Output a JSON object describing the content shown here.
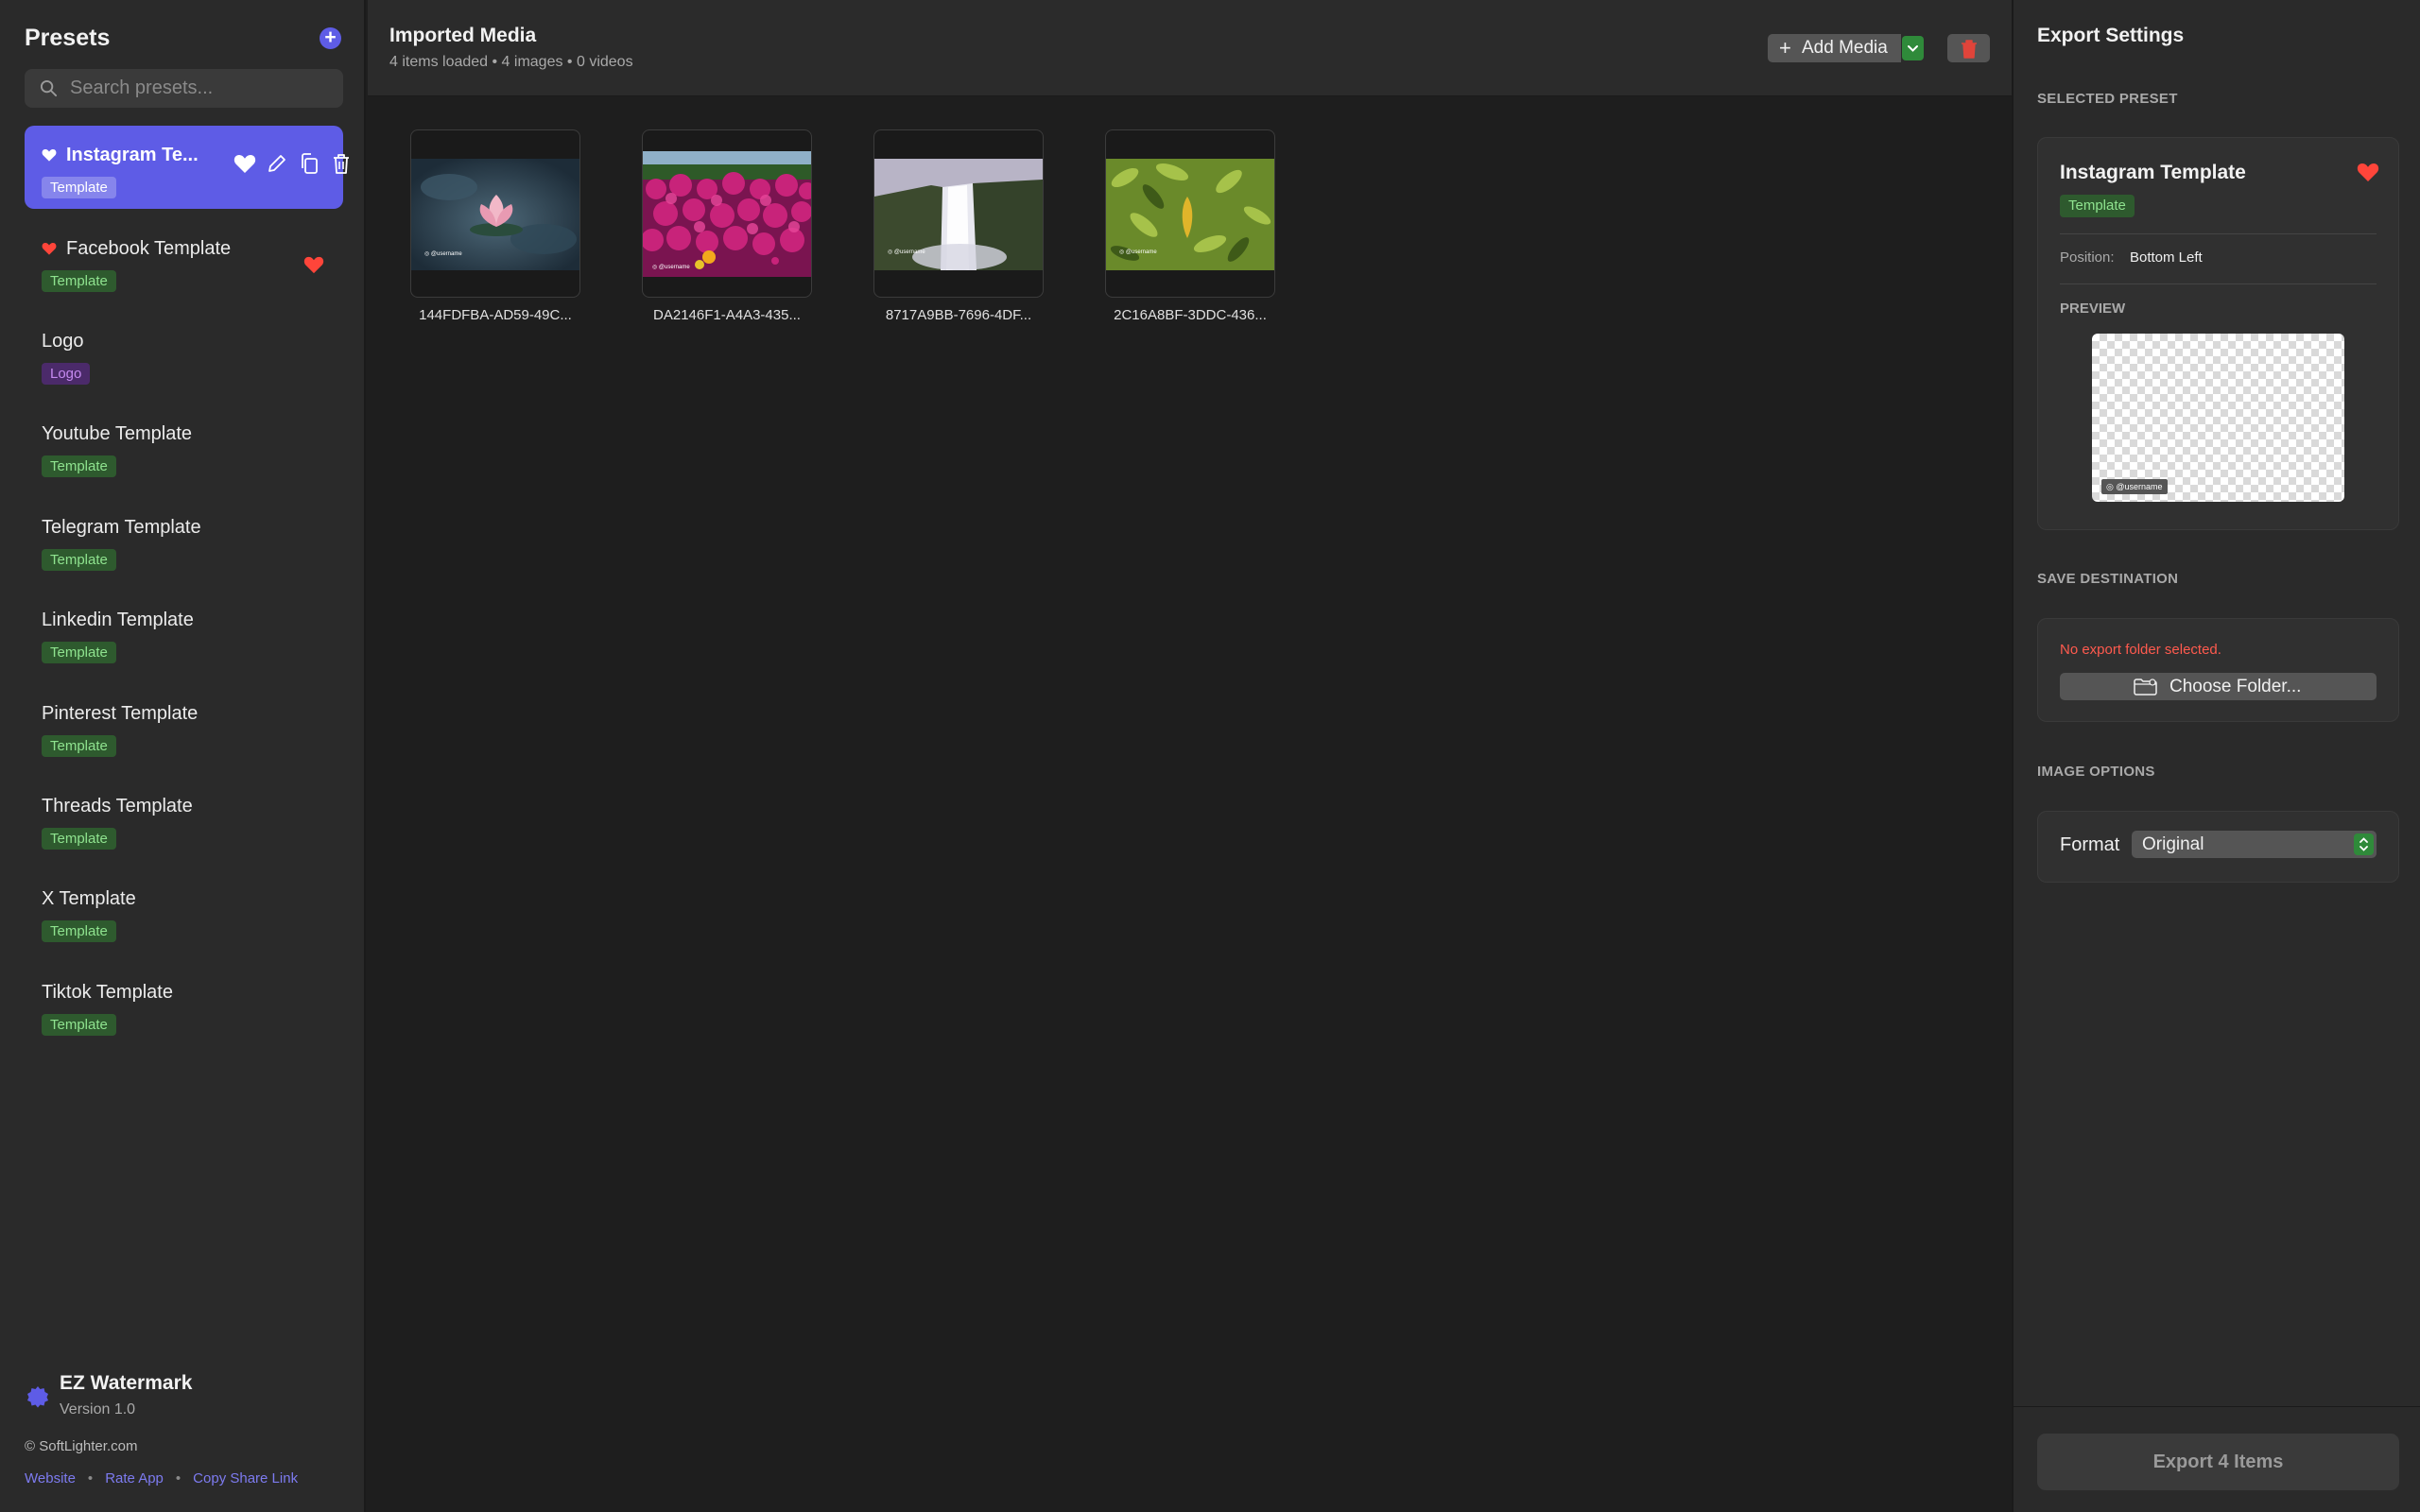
{
  "sidebar": {
    "title": "Presets",
    "search_placeholder": "Search presets...",
    "presets": [
      {
        "name": "Instagram Template",
        "short_name": "Instagram Te...",
        "tag": "Template",
        "favorite": true,
        "selected": true
      },
      {
        "name": "Facebook Template",
        "tag": "Template",
        "favorite": true,
        "selected": false
      },
      {
        "name": "Logo",
        "tag": "Logo",
        "favorite": false,
        "selected": false
      },
      {
        "name": "Youtube Template",
        "tag": "Template",
        "favorite": false,
        "selected": false
      },
      {
        "name": "Telegram Template",
        "tag": "Template",
        "favorite": false,
        "selected": false
      },
      {
        "name": "Linkedin Template",
        "tag": "Template",
        "favorite": false,
        "selected": false
      },
      {
        "name": "Pinterest Template",
        "tag": "Template",
        "favorite": false,
        "selected": false
      },
      {
        "name": "Threads Template",
        "tag": "Template",
        "favorite": false,
        "selected": false
      },
      {
        "name": "X Template",
        "tag": "Template",
        "favorite": false,
        "selected": false
      },
      {
        "name": "Tiktok Template",
        "tag": "Template",
        "favorite": false,
        "selected": false
      }
    ],
    "app": {
      "name": "EZ Watermark",
      "version": "Version 1.0"
    },
    "copyright": "© SoftLighter.com",
    "links": [
      "Website",
      "Rate App",
      "Copy Share Link"
    ]
  },
  "main": {
    "title": "Imported Media",
    "subtitle": "4 items loaded • 4 images • 0 videos",
    "add_media_label": "Add Media",
    "media": [
      {
        "name": "144FDFBA-AD59-49C...",
        "kind": "lotus",
        "watermark": "@username"
      },
      {
        "name": "DA2146F1-A4A3-435...",
        "kind": "flowers",
        "watermark": "@username"
      },
      {
        "name": "8717A9BB-7696-4DF...",
        "kind": "waterfall",
        "watermark": "@username"
      },
      {
        "name": "2C16A8BF-3DDC-436...",
        "kind": "leaves",
        "watermark": "@username"
      }
    ]
  },
  "export": {
    "title": "Export Settings",
    "selected_preset_label": "SELECTED PRESET",
    "preset_name": "Instagram Template",
    "preset_tag": "Template",
    "position_label": "Position:",
    "position_value": "Bottom Left",
    "preview_label": "PREVIEW",
    "watermark_text": "@username",
    "save_destination_label": "SAVE DESTINATION",
    "no_folder_text": "No export folder selected.",
    "choose_folder_label": "Choose Folder...",
    "image_options_label": "IMAGE OPTIONS",
    "format_label": "Format",
    "format_value": "Original",
    "export_button": "Export 4 Items"
  },
  "colors": {
    "accent": "#5e5ce6",
    "favorite": "#ff453a",
    "tag_template_text": "#8fe38f",
    "tag_logo_text": "#c58af0",
    "error": "#ff5a4e"
  }
}
